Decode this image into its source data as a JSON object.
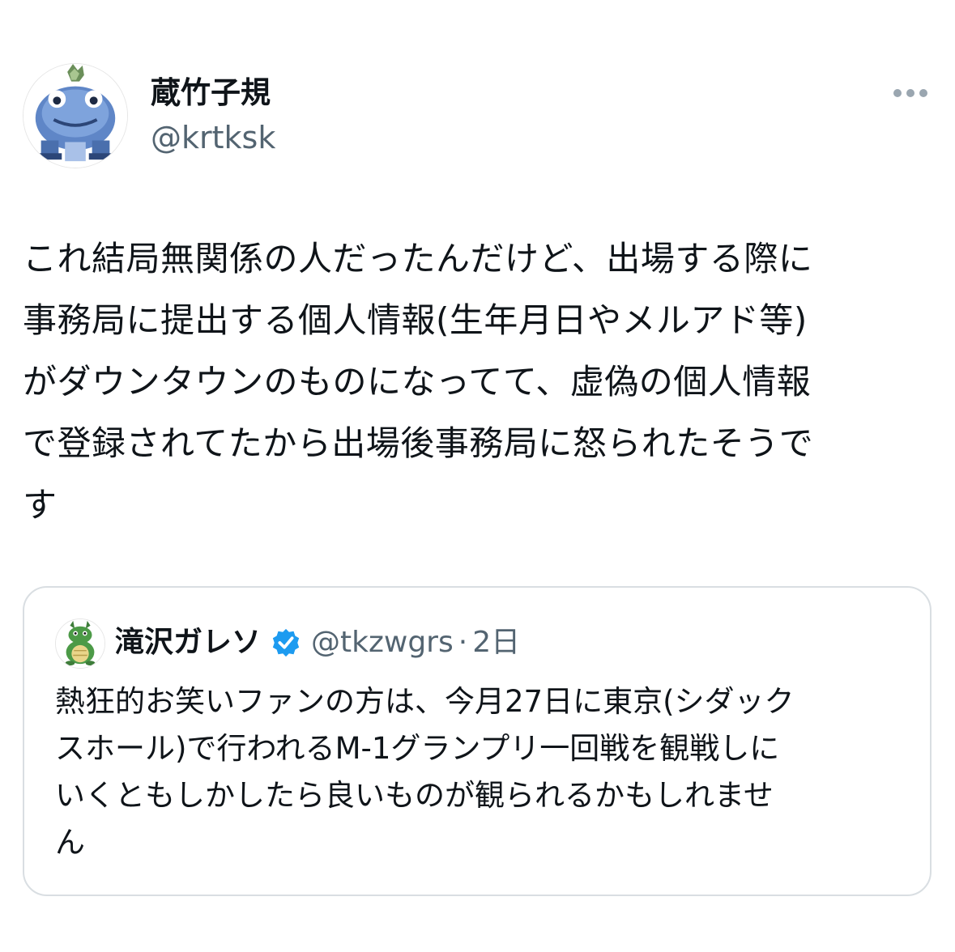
{
  "post": {
    "author": {
      "display_name": "蔵竹子規",
      "handle": "@krtksk",
      "avatar_icon": "pixel-frog-avatar"
    },
    "more_icon": "more-options-icon",
    "text": "これ結局無関係の人だったんだけど、出場する際に\n事務局に提出する個人情報(生年月日やメルアド等)\nがダウンタウンのものになってて、虚偽の個人情報\nで登録されてたから出場後事務局に怒られたそうで\nす"
  },
  "quoted_post": {
    "author": {
      "display_name": "滝沢ガレソ",
      "verified_icon": "verified-badge-icon",
      "handle": "@tkzwgrs",
      "separator": "·",
      "time": "2日",
      "avatar_icon": "dragon-avatar"
    },
    "text": "熱狂的お笑いファンの方は、今月27日に東京(シダック\nスホール)で行われるM-1グランプリ一回戦を観戦しに\nいくともしかしたら良いものが観られるかもしれませ\nん"
  },
  "colors": {
    "text_primary": "#0f1419",
    "text_secondary": "#536471",
    "verified_blue": "#1d9bf0",
    "quote_border": "#d9dee2"
  }
}
